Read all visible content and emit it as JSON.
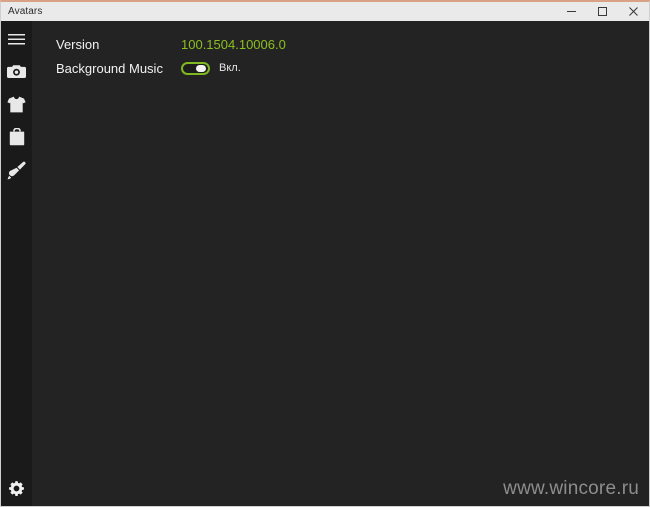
{
  "window": {
    "title": "Avatars",
    "accent_top_color": "#d9a185",
    "titlebar_bg": "#eaeaea",
    "sidebar_bg": "#1a1a1a",
    "content_bg": "#232323"
  },
  "caption_buttons": [
    {
      "name": "minimize-button",
      "icon": "minimize-icon",
      "label": "–"
    },
    {
      "name": "maximize-button",
      "icon": "maximize-icon",
      "label": "□"
    },
    {
      "name": "close-button",
      "icon": "close-icon",
      "label": "×"
    }
  ],
  "sidebar": {
    "items": [
      {
        "name": "sidebar-item-menu",
        "icon": "hamburger-menu-icon"
      },
      {
        "name": "sidebar-item-camera",
        "icon": "camera-icon"
      },
      {
        "name": "sidebar-item-clothing",
        "icon": "tshirt-icon"
      },
      {
        "name": "sidebar-item-store",
        "icon": "shopping-bag-icon"
      },
      {
        "name": "sidebar-item-styles",
        "icon": "paint-brush-icon"
      }
    ],
    "bottom_item": {
      "name": "sidebar-item-settings",
      "icon": "gear-icon"
    }
  },
  "settings": {
    "version": {
      "label": "Version",
      "value": "100.1504.10006.0",
      "value_color": "#8bbf1f"
    },
    "background_music": {
      "label": "Background Music",
      "state_label": "Вкл.",
      "toggle_on": true,
      "toggle_color": "#7fb821"
    }
  },
  "watermark": {
    "text": "www.wincore.ru"
  }
}
